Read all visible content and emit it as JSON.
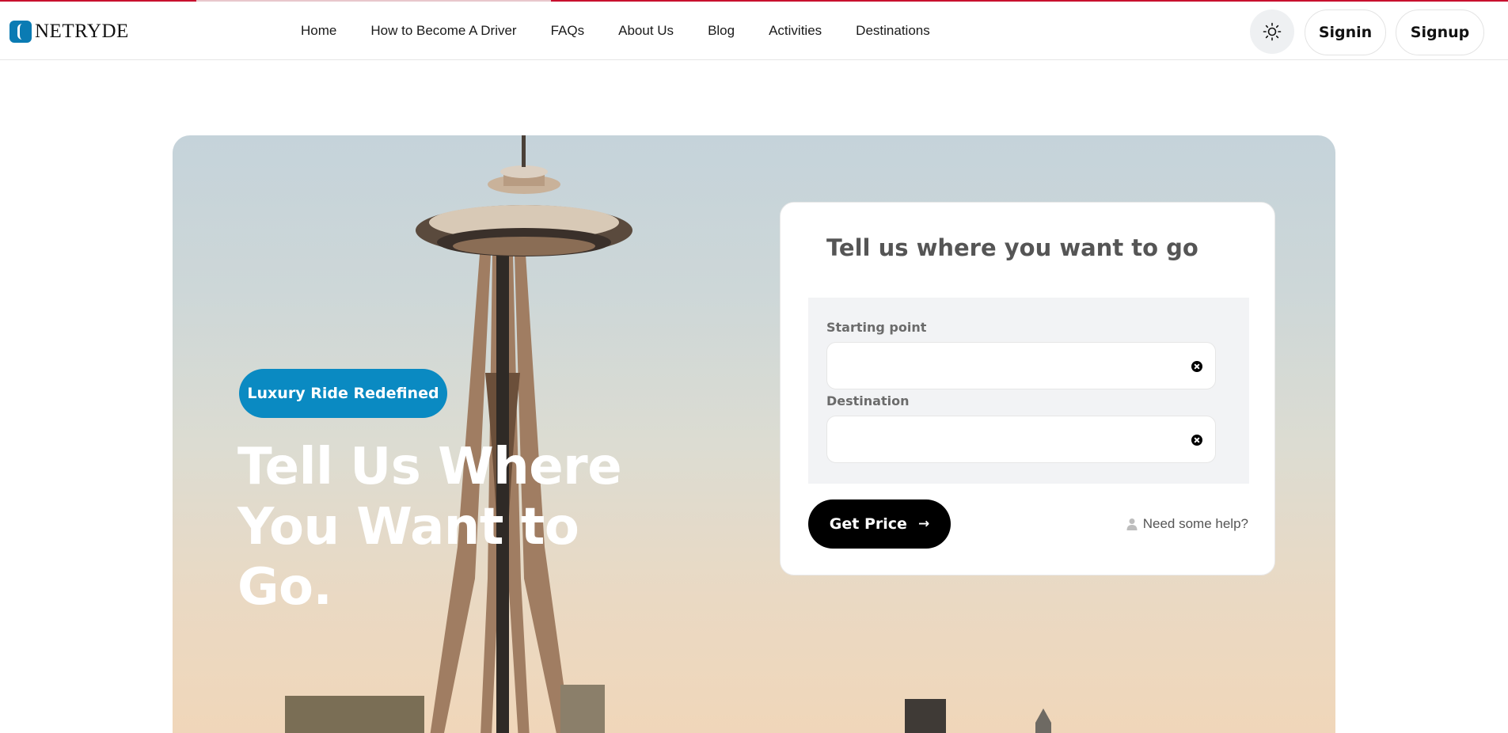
{
  "brand": {
    "name": "NETRYDE"
  },
  "nav": {
    "items": [
      {
        "label": "Home"
      },
      {
        "label": "How to Become A Driver"
      },
      {
        "label": "FAQs"
      },
      {
        "label": "About Us"
      },
      {
        "label": "Blog"
      },
      {
        "label": "Activities"
      },
      {
        "label": "Destinations"
      }
    ]
  },
  "header_actions": {
    "theme_icon": "sun-icon",
    "signin_label": "Signin",
    "signup_label": "Signup"
  },
  "hero": {
    "badge": "Luxury Ride Redefined",
    "title_line1": "Tell Us Where",
    "title_line2": "You Want to Go."
  },
  "booking": {
    "title": "Tell us where you want to go",
    "start_label": "Starting point",
    "start_value": "",
    "destination_label": "Destination",
    "destination_value": "",
    "submit_label": "Get Price",
    "submit_icon": "arrow-right-icon",
    "help_label": "Need some help?",
    "help_icon": "user-icon"
  },
  "colors": {
    "accent": "#0a8ac2",
    "topline": "#c8102e",
    "button_dark": "#000000"
  }
}
